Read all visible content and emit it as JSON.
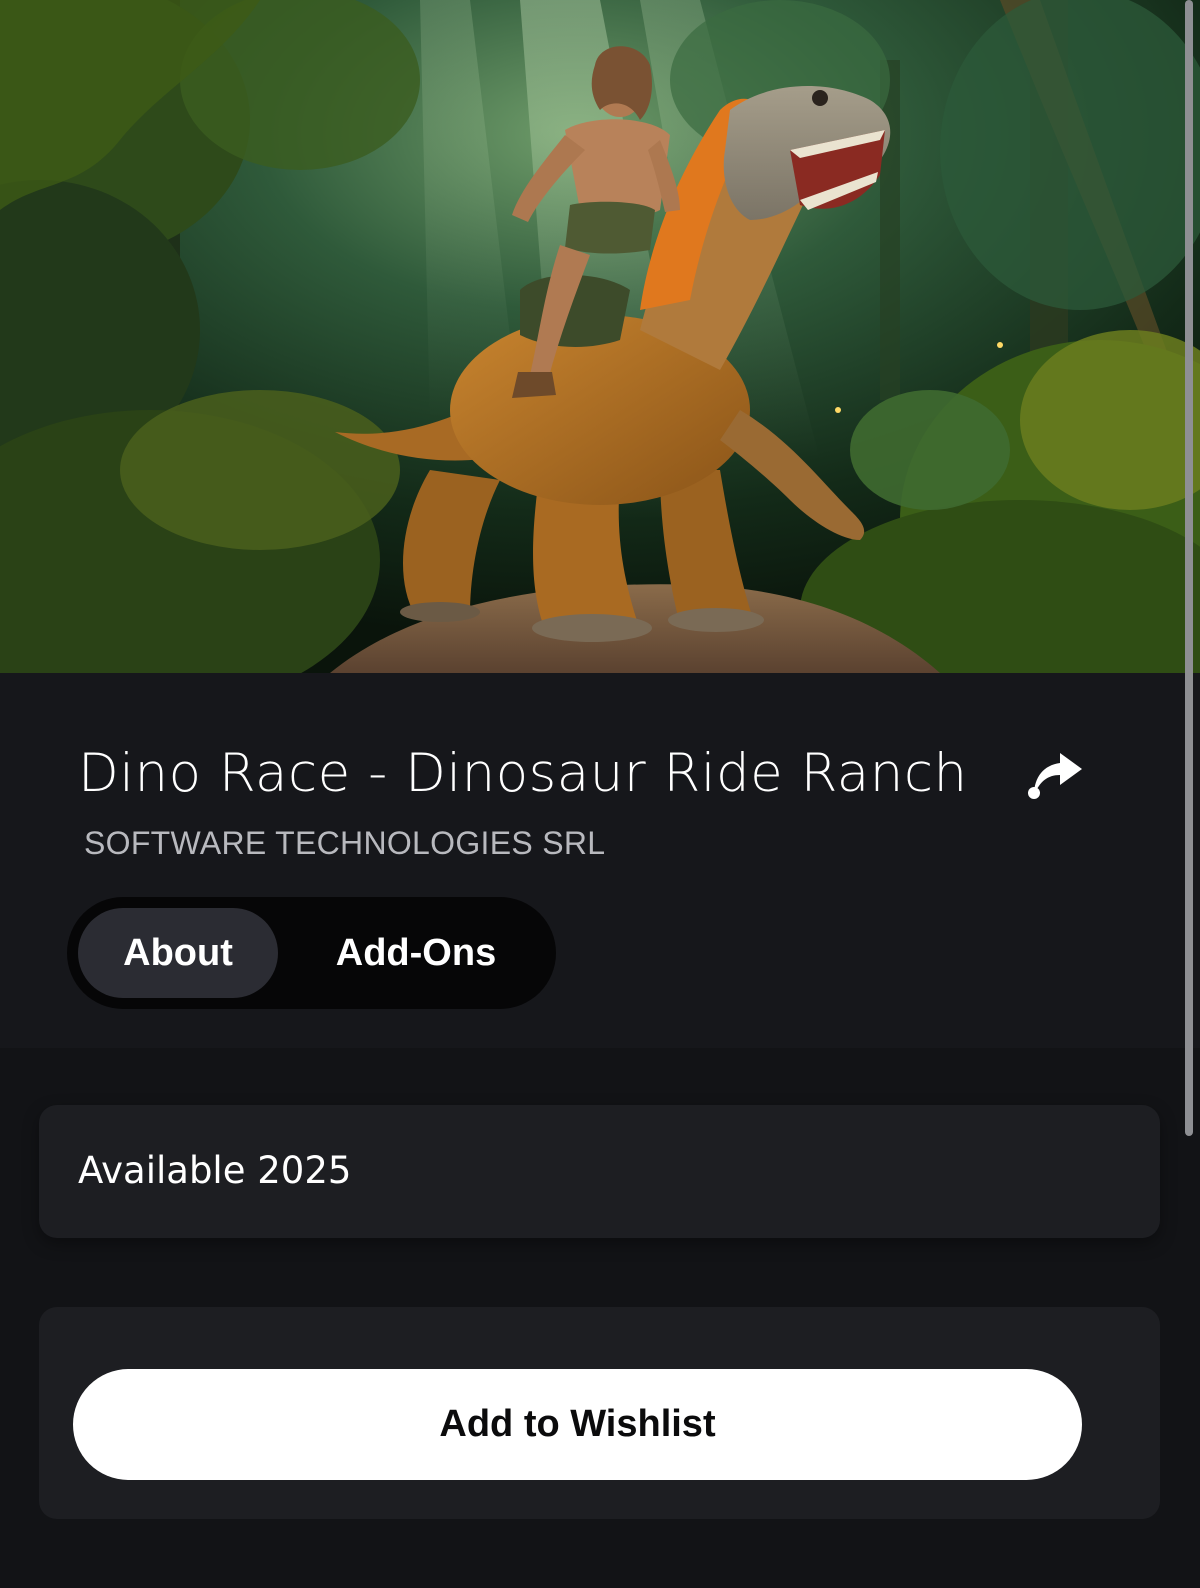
{
  "hero": {
    "image_description_icon": "hero-artwork"
  },
  "game": {
    "title": "Dino Race - Dinosaur Ride Ranch",
    "publisher": "SOFTWARE TECHNOLOGIES SRL"
  },
  "actions": {
    "share_icon": "share-arrow-icon"
  },
  "tabs": [
    {
      "label": "About",
      "selected": true
    },
    {
      "label": "Add-Ons",
      "selected": false
    }
  ],
  "availability": {
    "text": "Available 2025"
  },
  "wishlist": {
    "label": "Add to Wishlist"
  },
  "colors": {
    "background": "#121316",
    "header_bg": "#16171b",
    "card_bg": "#1d1e22",
    "tab_selected_bg": "#2b2c33",
    "tab_track_bg": "#060607",
    "primary_button_bg": "#ffffff",
    "primary_button_text": "#0b0b0c",
    "subtext": "#b8b9be"
  }
}
